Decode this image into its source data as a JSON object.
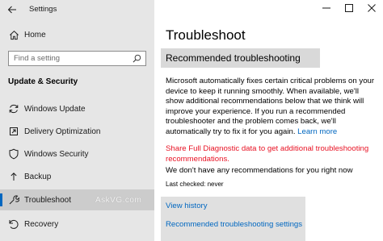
{
  "window": {
    "title": "Settings",
    "controls": {
      "minimize": "minimize",
      "maximize": "maximize",
      "close": "close"
    }
  },
  "sidebar": {
    "home_label": "Home",
    "search_placeholder": "Find a setting",
    "section_title": "Update & Security",
    "items": [
      {
        "label": "Windows Update",
        "icon": "sync-icon"
      },
      {
        "label": "Delivery Optimization",
        "icon": "delivery-icon"
      },
      {
        "label": "Windows Security",
        "icon": "shield-icon"
      },
      {
        "label": "Backup",
        "icon": "backup-icon"
      },
      {
        "label": "Troubleshoot",
        "icon": "wrench-icon",
        "selected": true
      },
      {
        "label": "Recovery",
        "icon": "recovery-icon"
      }
    ],
    "watermark": "AskVG.com"
  },
  "main": {
    "page_title": "Troubleshoot",
    "banner": "Recommended troubleshooting",
    "description": "Microsoft automatically fixes certain critical problems on your device to keep it running smoothly. When available, we'll show additional recommendations below that we think will improve your experience. If you run a recommended troubleshooter and the problem comes back, we'll automatically try to fix it for you again.",
    "learn_more": "Learn more",
    "diagnostic_warning": "Share Full Diagnostic data to get additional troubleshooting recommendations.",
    "no_recommendations": "We don't have any recommendations for you right now",
    "last_checked": "Last checked: never",
    "links": {
      "view_history": "View history",
      "recommended_settings": "Recommended troubleshooting settings"
    }
  },
  "colors": {
    "accent": "#0067c0",
    "warning": "#e81123",
    "sidebar_bg": "#e6e6e6",
    "selected_bg": "#cccccc"
  }
}
